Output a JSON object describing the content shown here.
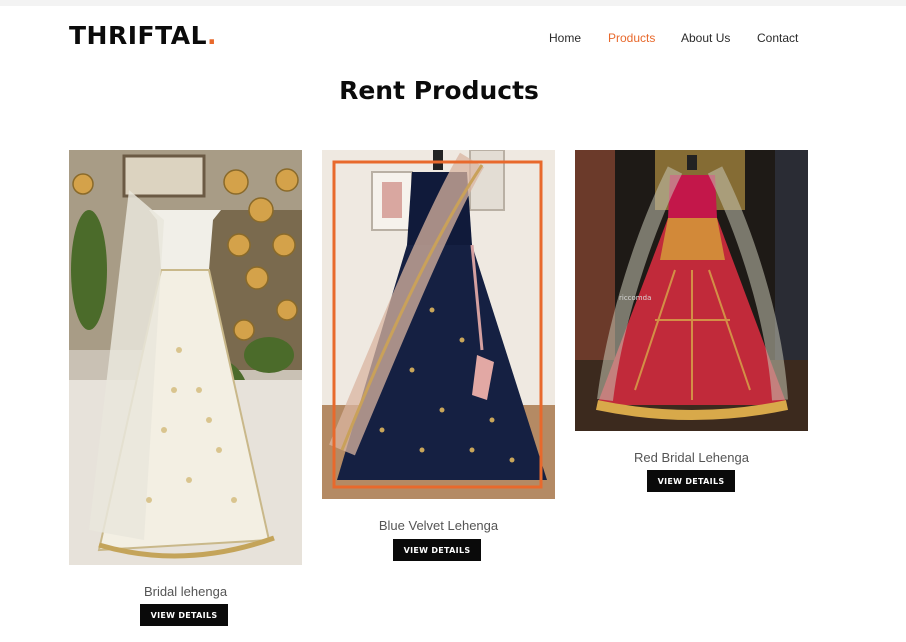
{
  "brand": {
    "name": "THRIFTAL",
    "dot": ".",
    "accent_color": "#e8692c"
  },
  "nav": {
    "items": [
      {
        "label": "Home",
        "active": false
      },
      {
        "label": "Products",
        "active": true
      },
      {
        "label": "About Us",
        "active": false
      },
      {
        "label": "Contact",
        "active": false
      }
    ]
  },
  "page": {
    "title": "Rent Products"
  },
  "products": [
    {
      "name": "Bridal lehenga",
      "button_label": "VIEW DETAILS",
      "image": "ivory-bridal-lehenga-photo"
    },
    {
      "name": "Blue Velvet Lehenga",
      "button_label": "VIEW DETAILS",
      "image": "navy-velvet-lehenga-photo"
    },
    {
      "name": "Red Bridal Lehenga",
      "button_label": "VIEW DETAILS",
      "image": "red-bridal-lehenga-photo",
      "watermark": "riccomda"
    }
  ]
}
